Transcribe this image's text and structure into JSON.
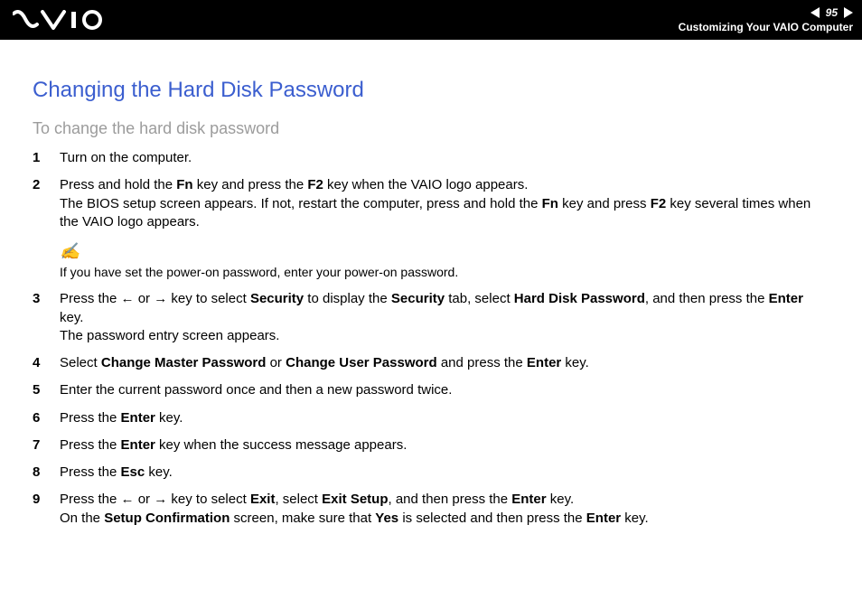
{
  "header": {
    "page_number": "95",
    "section": "Customizing Your VAIO Computer"
  },
  "title": "Changing the Hard Disk Password",
  "subtitle": "To change the hard disk password",
  "note_text": "If you have set the power-on password, enter your power-on password.",
  "steps": {
    "s1": "Turn on the computer.",
    "s2_a": "Press and hold the ",
    "s2_b": " key and press the ",
    "s2_c": " key when the VAIO logo appears.",
    "s2_d": "The BIOS setup screen appears. If not, restart the computer, press and hold the ",
    "s2_e": " key and press ",
    "s2_f": " key several times when the VAIO logo appears.",
    "s3_a": "Press the ",
    "s3_b": " or ",
    "s3_c": " key to select ",
    "s3_d": " to display the ",
    "s3_e": " tab, select ",
    "s3_f": ", and then press the ",
    "s3_g": " key.",
    "s3_h": "The password entry screen appears.",
    "s4_a": "Select ",
    "s4_b": " or ",
    "s4_c": " and press the ",
    "s4_d": " key.",
    "s5": "Enter the current password once and then a new password twice.",
    "s6_a": "Press the ",
    "s6_b": " key.",
    "s7_a": "Press the ",
    "s7_b": " key when the success message appears.",
    "s8_a": "Press the ",
    "s8_b": " key.",
    "s9_a": "Press the ",
    "s9_b": " or ",
    "s9_c": " key to select ",
    "s9_d": ", select ",
    "s9_e": ", and then press the ",
    "s9_f": " key.",
    "s9_g": "On the ",
    "s9_h": " screen, make sure that ",
    "s9_i": " is selected and then press the ",
    "s9_j": " key."
  },
  "bold": {
    "fn": "Fn",
    "f2": "F2",
    "security": "Security",
    "hard_disk_password": "Hard Disk Password",
    "enter": "Enter",
    "change_master_password": "Change Master Password",
    "change_user_password": "Change User Password",
    "esc": "Esc",
    "exit": "Exit",
    "exit_setup": "Exit Setup",
    "setup_confirmation": "Setup Confirmation",
    "yes": "Yes"
  }
}
